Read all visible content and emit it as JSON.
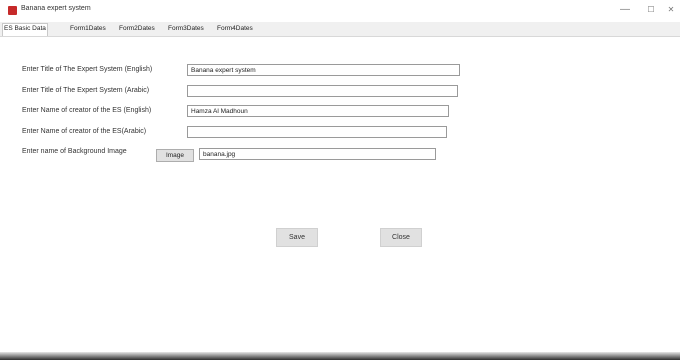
{
  "window": {
    "title": "Banana expert system",
    "minimize_glyph": "—",
    "maximize_glyph": "☐",
    "close_glyph": "✕"
  },
  "tabs": [
    {
      "label": "ES Basic Data",
      "active": true
    },
    {
      "label": "Form1Dates",
      "active": false
    },
    {
      "label": "Form2Dates",
      "active": false
    },
    {
      "label": "Form3Dates",
      "active": false
    },
    {
      "label": "Form4Dates",
      "active": false
    }
  ],
  "form": {
    "title_en_label": "Enter Title of The Expert System (English)",
    "title_en_value": "Banana expert system",
    "title_ar_label": "Enter Title of The Expert System (Arabic)",
    "title_ar_value": "",
    "creator_en_label": "Enter Name of creator of the ES (English)",
    "creator_en_value": "Hamza Al Madhoun",
    "creator_ar_label": "Enter Name of creator of the ES(Arabic)",
    "creator_ar_value": "",
    "background_label": "Enter name of Background Image",
    "image_button": "Image",
    "background_value": "banana.jpg"
  },
  "actions": {
    "save": "Save",
    "close": "Close"
  },
  "colors": {
    "icon": "#c62a2a",
    "tabstrip": "#f0f0f0",
    "button": "#e1e1e1"
  }
}
